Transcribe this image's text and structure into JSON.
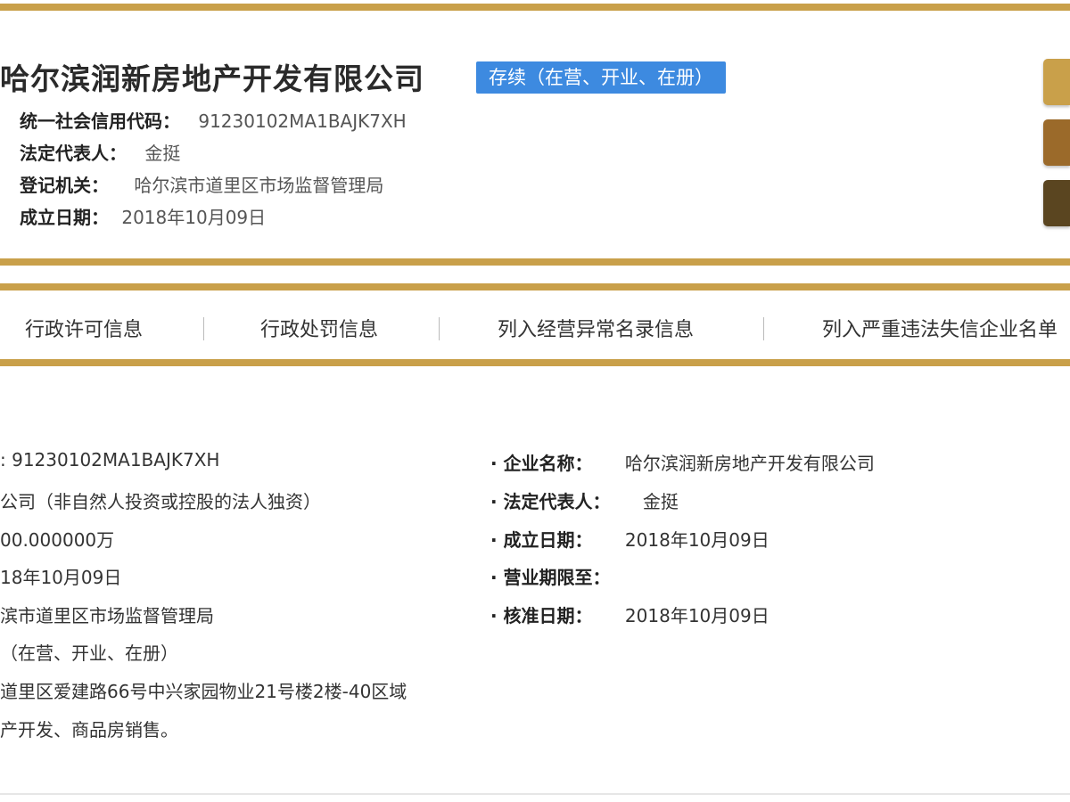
{
  "company": {
    "name": "哈尔滨润新房地产开发有限公司",
    "status": "存续（在营、开业、在册）"
  },
  "summary": [
    {
      "label": "统一社会信用代码：",
      "value": "91230102MA1BAJK7XH"
    },
    {
      "label": "法定代表人：",
      "value": "金挺"
    },
    {
      "label": "登记机关：",
      "value": "哈尔滨市道里区市场监督管理局"
    },
    {
      "label": "成立日期：",
      "value": "2018年10月09日"
    }
  ],
  "side_buttons": {
    "colors": [
      "#c9a04a",
      "#9b6a2a",
      "#5a4520"
    ]
  },
  "nav": {
    "items": [
      "行政许可信息",
      "行政处罚信息",
      "列入经营异常名录信息",
      "列入严重违法失信企业名单"
    ]
  },
  "details_left": [
    ":    91230102MA1BAJK7XH",
    "公司（非自然人投资或控股的法人独资）",
    "00.000000万",
    "18年10月09日",
    "滨市道里区市场监督管理局",
    "（在营、开业、在册）",
    "道里区爱建路66号中兴家园物业21号楼2楼-40区域",
    "产开发、商品房销售。"
  ],
  "details_right": [
    {
      "label": "· 企业名称：",
      "value": "哈尔滨润新房地产开发有限公司"
    },
    {
      "label": "· 法定代表人：",
      "value": "金挺"
    },
    {
      "label": "· 成立日期：",
      "value": "2018年10月09日"
    },
    {
      "label": "· 营业期限至：",
      "value": ""
    },
    {
      "label": "· 核准日期：",
      "value": "2018年10月09日"
    }
  ],
  "colors": {
    "accent_gold": "#c9a04a",
    "badge_blue": "#3d8ae0"
  }
}
